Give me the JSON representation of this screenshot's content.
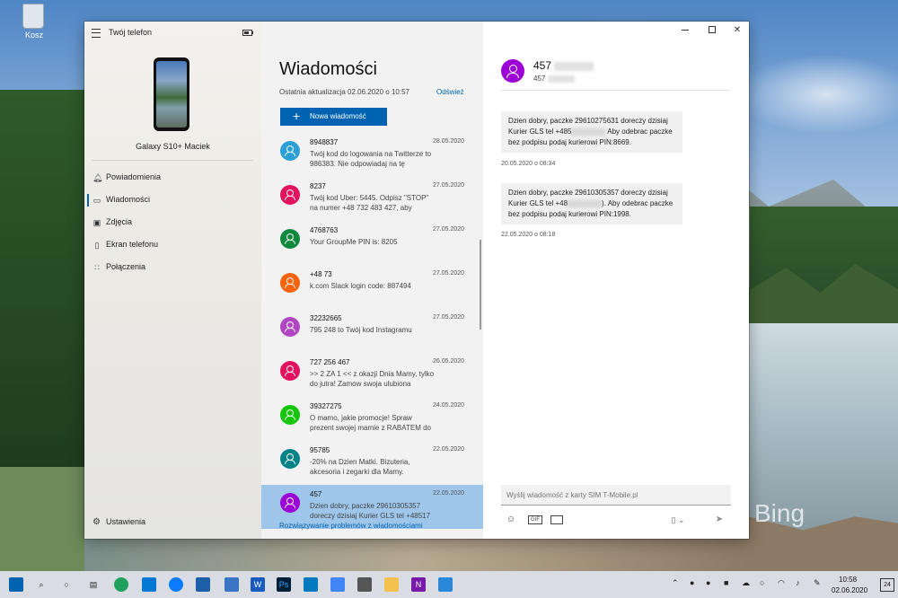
{
  "desktop": {
    "recycle_label": "Kosz",
    "bing": "Bing"
  },
  "app": {
    "title": "Twój telefon",
    "device_name": "Galaxy S10+ Maciek",
    "nav": [
      {
        "label": "Powiadomienia",
        "icon": "bell-icon"
      },
      {
        "label": "Wiadomości",
        "icon": "chat-icon"
      },
      {
        "label": "Zdjęcia",
        "icon": "photo-icon"
      },
      {
        "label": "Ekran telefonu",
        "icon": "screen-icon"
      },
      {
        "label": "Połączenia",
        "icon": "dialpad-icon"
      }
    ],
    "settings_label": "Ustawienia"
  },
  "messages": {
    "title": "Wiadomości",
    "last_update": "Ostatnia aktualizacja 02.06.2020 o 10:57",
    "refresh": "Odśwież",
    "new_message": "Nowa wiadomość",
    "troubleshoot": "Rozwiązywanie problemów z wiadomościami",
    "conversations": [
      {
        "name": "8948837",
        "date": "28.05.2020",
        "preview": "Twój kod do logowania na Twitterze to 986383. Nie odpowiadaj na tę wiadomość",
        "color": "#2d9fd8"
      },
      {
        "name": "8237",
        "date": "27.05.2020",
        "preview": "Twój kod Uber: 5445. Odpisz \"STOP\" na numer +48 732 483 427, aby",
        "color": "#e3125e"
      },
      {
        "name": "4768763",
        "date": "27.05.2020",
        "preview": "Your GroupMe PIN is: 8205",
        "color": "#10893e"
      },
      {
        "name": "+48 73",
        "date": "27.05.2020",
        "preview": "k.com Slack login code: 887494",
        "color": "#f7630c"
      },
      {
        "name": "32232665",
        "date": "27.05.2020",
        "preview": "795 248 to Twój kod Instagramu",
        "color": "#b146c2"
      },
      {
        "name": "727 256 467",
        "date": "26.05.2020",
        "preview": ">> 2 ZA 1 << z okazji Dnia Mamy, tylko do jutra! Zamow swoja ulubiona",
        "color": "#e3125e"
      },
      {
        "name": "39327275",
        "date": "24.05.2020",
        "preview": "O mamo, jakie promocje! Spraw prezent swojej mamie z RABATEM do",
        "color": "#16c60c"
      },
      {
        "name": "95785",
        "date": "22.05.2020",
        "preview": "-20% na Dzien Matki. Bizuteria, akcesoria i zegarki dla Mamy. Szczegoly",
        "color": "#038387"
      },
      {
        "name": "457",
        "date": "22.05.2020",
        "preview": "Dzien dobry, paczke 29610305357 doreczy dzisiaj Kurier GLS tel +48517",
        "color": "#9c00d6"
      }
    ]
  },
  "thread": {
    "name": "457",
    "number": "457",
    "messages": [
      {
        "text": "Dzien dobry, paczke 29610275631 doreczy dzisiaj Kurier GLS tel +485",
        "text2": "Aby odebrac paczke bez podpisu podaj kurierowi PIN:8669.",
        "time": "20.05.2020 o 08:34"
      },
      {
        "text": "Dzien dobry, paczke 29610305357 doreczy dzisiaj Kurier GLS tel +48",
        "text2": "). Aby odebrac paczke bez podpisu podaj kurierowi PIN:1998.",
        "time": "22.05.2020 o 08:18"
      }
    ],
    "compose_placeholder": "Wyślij wiadomość z karty SIM T-Mobile.pl",
    "gif_label": "GIF"
  },
  "taskbar": {
    "time": "10:58",
    "date": "02.06.2020",
    "notifications": "24"
  }
}
